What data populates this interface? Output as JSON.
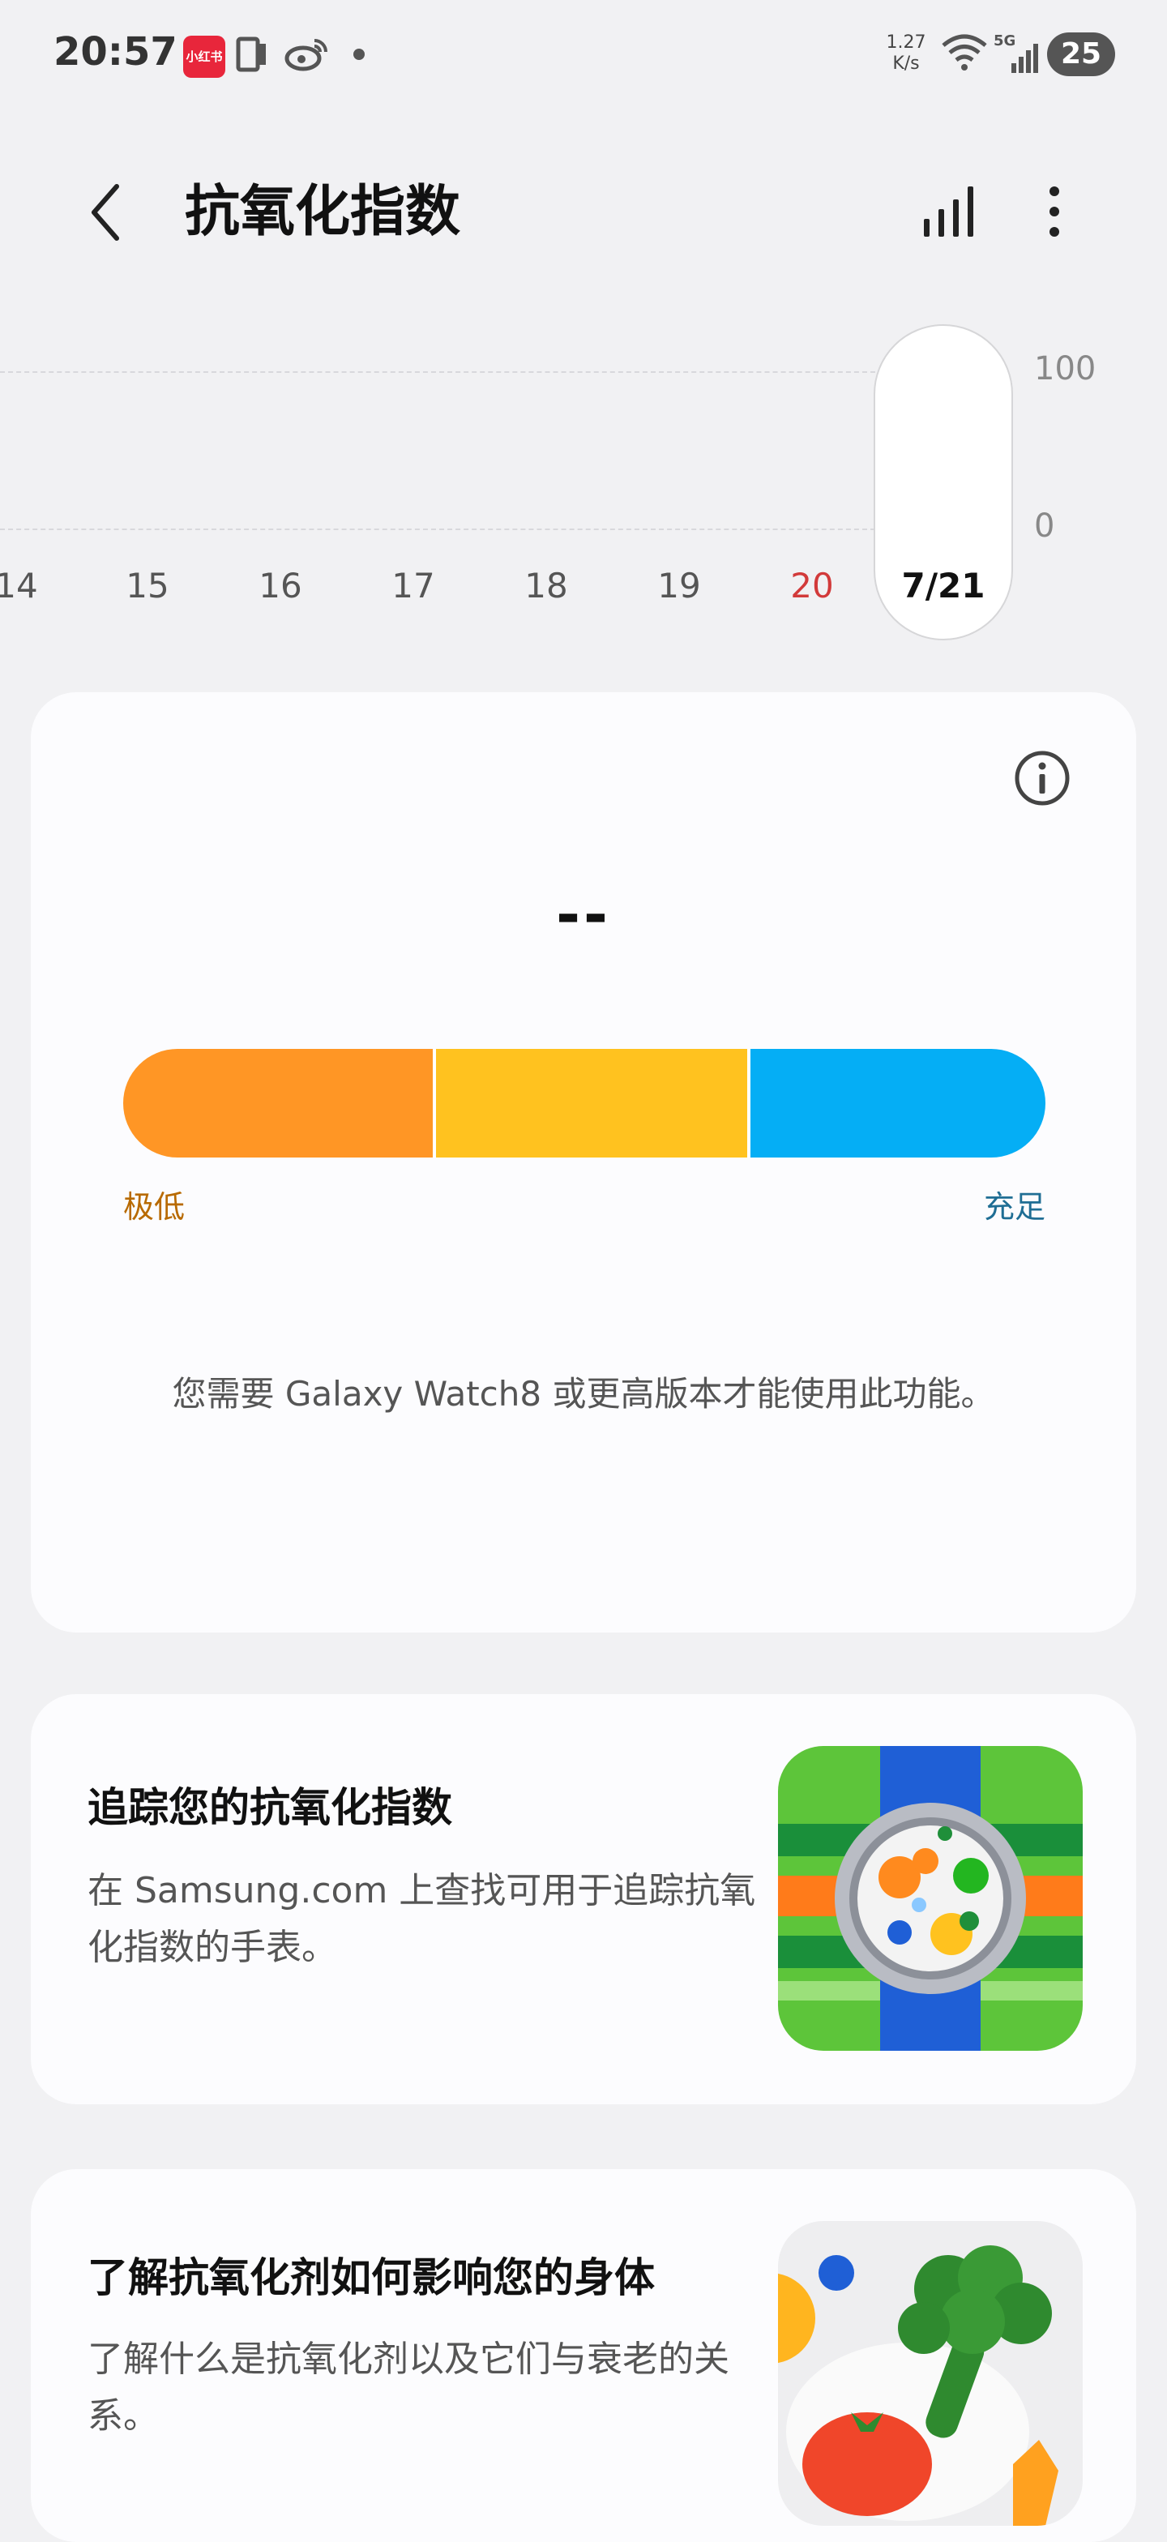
{
  "status_bar": {
    "time": "20:57",
    "app_badge": "小红书",
    "net_speed_value": "1.27",
    "net_speed_unit": "K/s",
    "network": "5G",
    "battery": "25"
  },
  "header": {
    "title": "抗氧化指数",
    "icons": [
      "back-arrow-icon",
      "bar-chart-icon",
      "more-vert-icon"
    ]
  },
  "date_chart": {
    "y_max": "100",
    "y_min": "0",
    "days": [
      "14",
      "15",
      "16",
      "17",
      "18",
      "19",
      "20"
    ],
    "selected": "7/21",
    "colors": {
      "sunday": "#d23a3a",
      "grid": "#d8d8dc"
    }
  },
  "index_card": {
    "value": "--",
    "scale_low": "极低",
    "scale_high": "充足",
    "scale_colors": [
      "#ff9625",
      "#ffc21f",
      "#05aef5"
    ],
    "notice": "您需要 Galaxy Watch8 或更高版本才能使用此功能。"
  },
  "cards": [
    {
      "title": "追踪您的抗氧化指数",
      "desc": "在 Samsung.com 上查找可用于追踪抗氧化指数的手表。",
      "image": "galaxy-watch-illustration"
    },
    {
      "title": "了解抗氧化剂如何影响您的身体",
      "desc": "了解什么是抗氧化剂以及它们与衰老的关系。",
      "image": "vegetables-illustration"
    }
  ]
}
